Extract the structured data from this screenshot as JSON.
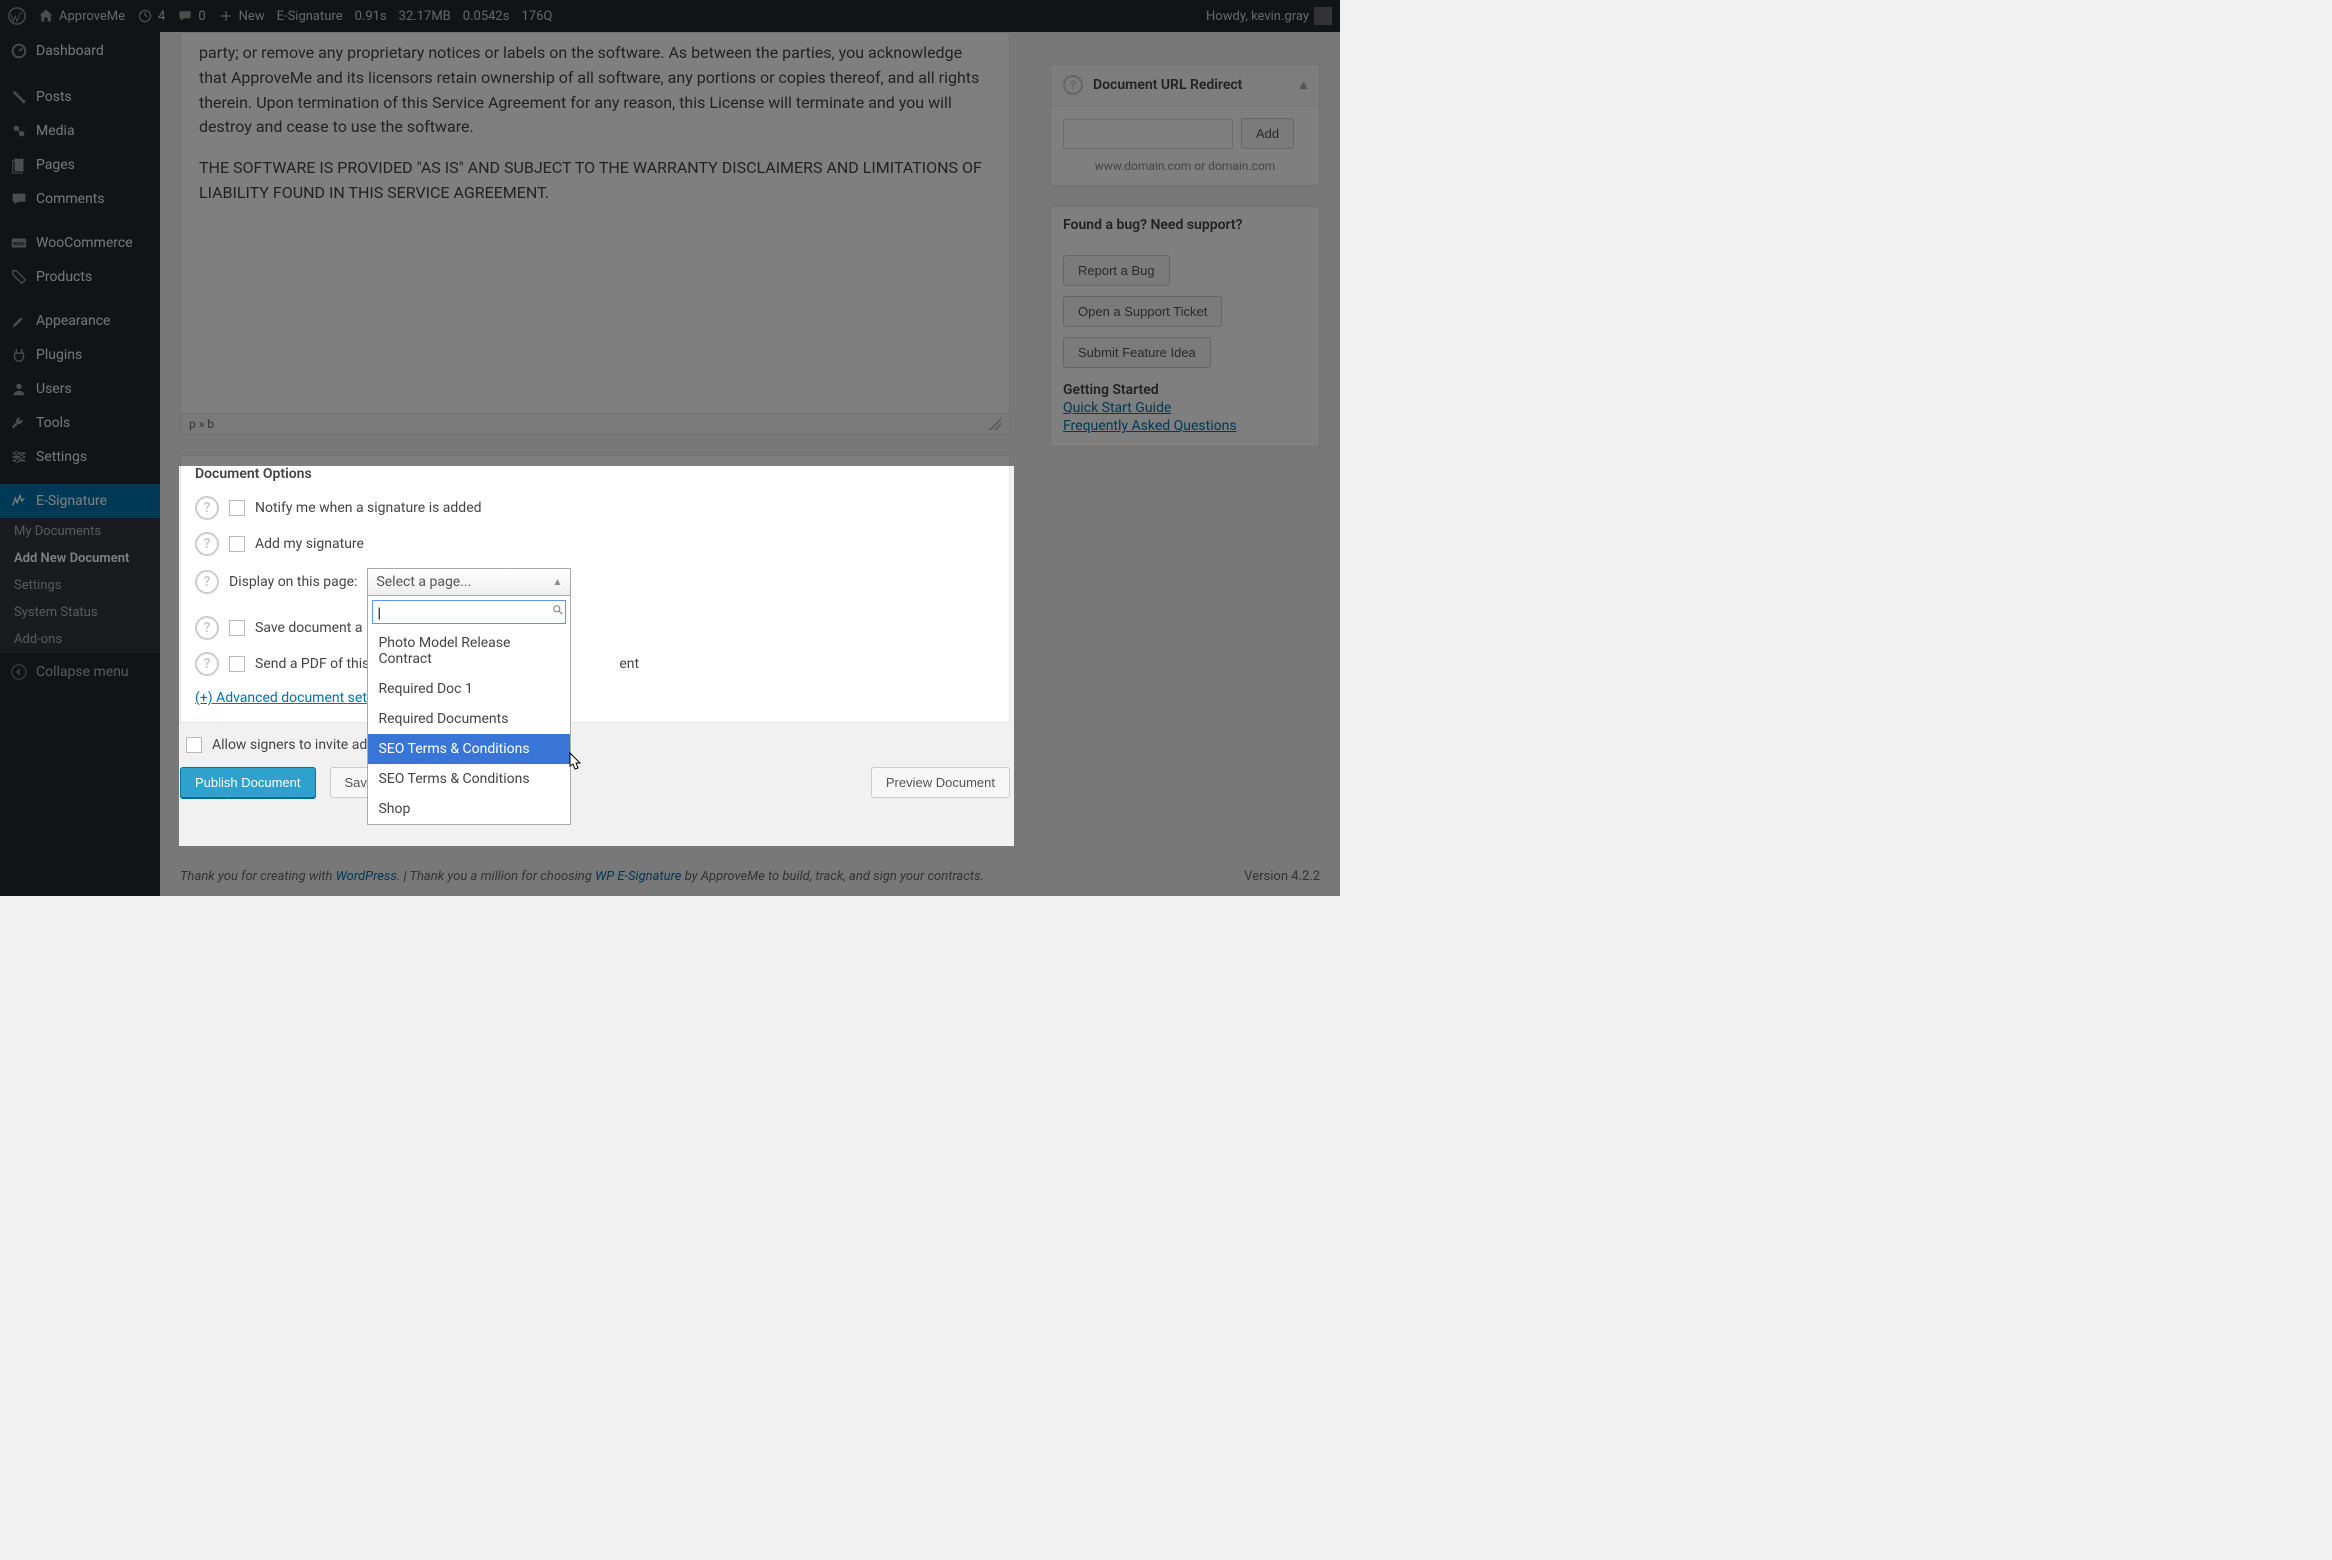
{
  "adminbar": {
    "site": "ApproveMe",
    "updates": "4",
    "comments": "0",
    "new": "New",
    "menu_label": "E-Signature",
    "stat_time": "0.91s",
    "stat_mem": "32.17MB",
    "stat_q": "0.0542s",
    "stat_qn": "176Q",
    "howdy": "Howdy, kevin.gray"
  },
  "sidebar": {
    "items": [
      "Dashboard",
      "Posts",
      "Media",
      "Pages",
      "Comments",
      "WooCommerce",
      "Products",
      "Appearance",
      "Plugins",
      "Users",
      "Tools",
      "Settings",
      "E-Signature"
    ],
    "sub": [
      "My Documents",
      "Add New Document",
      "Settings",
      "System Status",
      "Add-ons"
    ],
    "collapse": "Collapse menu"
  },
  "editor": {
    "p1": "party; or remove any proprietary notices or labels on the software. As between the parties, you acknowledge that ApproveMe and its licensors retain ownership of all software, any portions or copies thereof, and all rights therein. Upon termination of this Service Agreement for any reason, this License will terminate and you will destroy and cease to use the software.",
    "p2": "THE SOFTWARE IS PROVIDED \"AS IS\" AND SUBJECT TO THE WARRANTY DISCLAIMERS AND LIMITATIONS OF LIABILITY FOUND IN THIS SERVICE AGREEMENT.",
    "path": "p » b"
  },
  "options": {
    "title": "Document Options",
    "notify": "Notify me when a signature is added",
    "addsig": "Add my signature",
    "display_label": "Display on this page:",
    "select_placeholder": "Select a page...",
    "savepdf": "Save document a",
    "sendpdf": "Send a PDF of this",
    "sendpdf_tail": "ent",
    "advanced": "(+) Advanced document settin"
  },
  "dropdown": {
    "search_value": "|",
    "items": [
      "Photo Model Release Contract",
      "Required Doc 1",
      "Required Documents",
      "SEO Terms & Conditions",
      "SEO Terms & Conditions",
      "Shop"
    ],
    "highlight_index": 3
  },
  "allow": "Allow signers to invite additi",
  "buttons": {
    "publish": "Publish Document",
    "save": "Save a",
    "preview": "Preview Document"
  },
  "redirect": {
    "title": "Document URL Redirect",
    "add": "Add",
    "hint": "www.domain.com or domain.com"
  },
  "support": {
    "title": "Found a bug? Need support?",
    "report": "Report a Bug",
    "ticket": "Open a Support Ticket",
    "idea": "Submit Feature Idea",
    "getting": "Getting Started",
    "quick": "Quick Start Guide",
    "faq": "Frequently Asked Questions"
  },
  "footer": {
    "p1": "Thank you for creating with ",
    "wp": "WordPress",
    "p2": ". | Thank you a million for choosing ",
    "plugin": "WP E-Signature",
    "p3": " by ApproveMe to build, track, and sign your contracts.",
    "version": "Version 4.2.2"
  }
}
